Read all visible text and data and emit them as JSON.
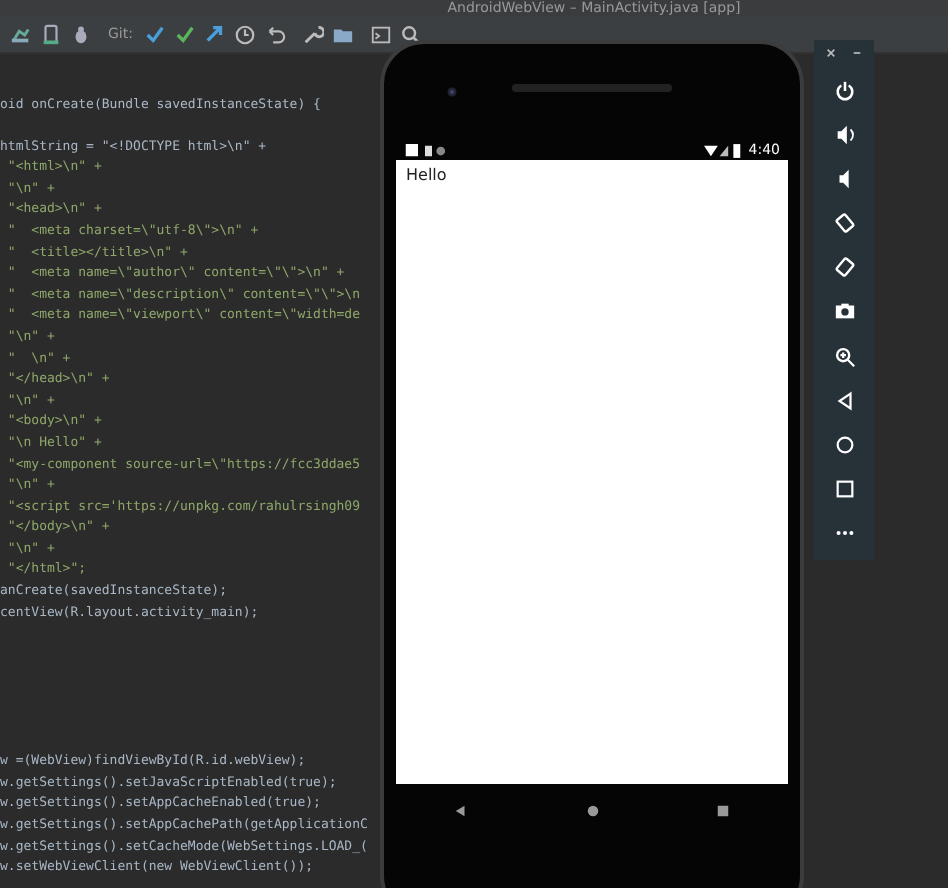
{
  "window": {
    "title": "AndroidWebView – MainActivity.java [app]"
  },
  "toolbar": {
    "vcs_label": "Git:"
  },
  "code_blocks": [
    {
      "lines": [
        {
          "kind": "code",
          "text": "oid onCreate(Bundle savedInstanceState) {"
        }
      ]
    },
    {
      "lines": [
        {
          "kind": "code",
          "text": "htmlString = \"<!DOCTYPE html>\\n\" +"
        },
        {
          "kind": "string",
          "text": " \"<html>\\n\" +"
        },
        {
          "kind": "string",
          "text": " \"\\n\" +"
        },
        {
          "kind": "string",
          "text": " \"<head>\\n\" +"
        },
        {
          "kind": "string",
          "text": " \"  <meta charset=\\\"utf-8\\\">\\n\" +"
        },
        {
          "kind": "string",
          "text": " \"  <title></title>\\n\" +"
        },
        {
          "kind": "string",
          "text": " \"  <meta name=\\\"author\\\" content=\\\"\\\">\\n\" +"
        },
        {
          "kind": "string",
          "text": " \"  <meta name=\\\"description\\\" content=\\\"\\\">\\n"
        },
        {
          "kind": "string",
          "text": " \"  <meta name=\\\"viewport\\\" content=\\\"width=de"
        },
        {
          "kind": "string",
          "text": " \"\\n\" +"
        },
        {
          "kind": "string",
          "text": " \"  \\n\" +"
        },
        {
          "kind": "string",
          "text": " \"</head>\\n\" +"
        },
        {
          "kind": "string",
          "text": " \"\\n\" +"
        },
        {
          "kind": "string",
          "text": " \"<body>\\n\" +"
        },
        {
          "kind": "string",
          "text": " \"\\n Hello\" +"
        },
        {
          "kind": "string",
          "text": " \"<my-component source-url=\\\"https://fcc3ddae5"
        },
        {
          "kind": "string",
          "text": " \"\\n\" +"
        },
        {
          "kind": "string",
          "text": " \"<script src='https://unpkg.com/rahulrsingh09"
        },
        {
          "kind": "string",
          "text": " \"</body>\\n\" +"
        },
        {
          "kind": "string",
          "text": " \"\\n\" +"
        },
        {
          "kind": "string",
          "text": " \"</html>\";"
        },
        {
          "kind": "code",
          "text": "anCreate(savedInstanceState);"
        },
        {
          "kind": "code",
          "text": "centView(R.layout.activity_main);"
        }
      ]
    },
    {
      "lines": [
        {
          "kind": "code",
          "text": "w =(WebView)findViewById(R.id.webView);"
        },
        {
          "kind": "code",
          "text": "w.getSettings().setJavaScriptEnabled(true);"
        },
        {
          "kind": "code",
          "text": "w.getSettings().setAppCacheEnabled(true);"
        },
        {
          "kind": "code",
          "text": "w.getSettings().setAppCachePath(getApplicationC"
        },
        {
          "kind": "code",
          "text": "w.getSettings().setCacheMode(WebSettings.LOAD_("
        },
        {
          "kind": "code",
          "text": "w.setWebViewClient(new WebViewClient());"
        }
      ]
    }
  ],
  "phone": {
    "status_time": "4:40",
    "page_text": "Hello"
  }
}
